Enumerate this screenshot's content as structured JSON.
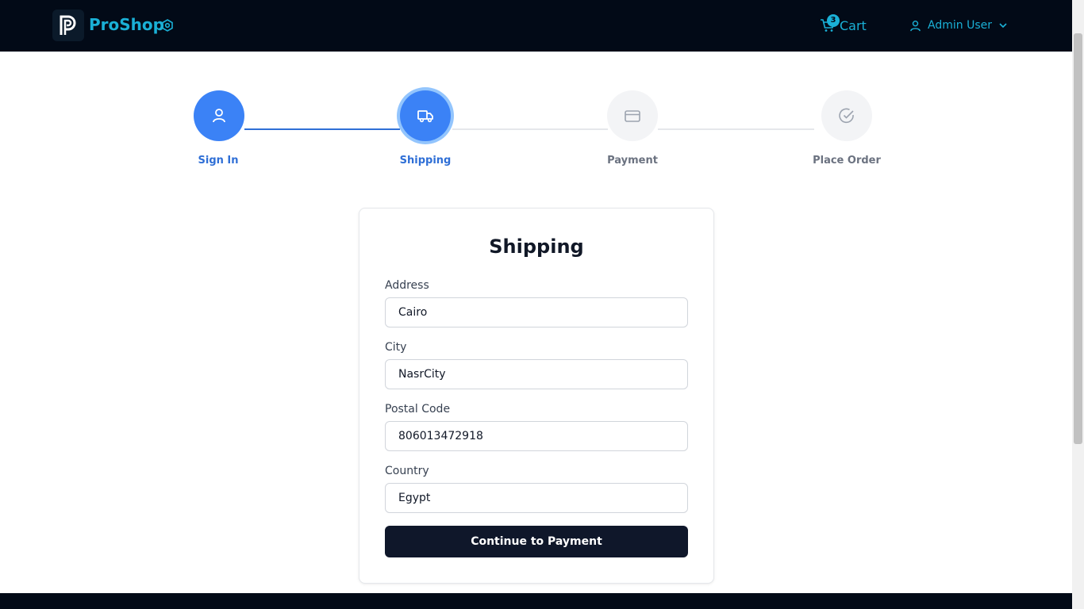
{
  "header": {
    "brand": "ProShop",
    "brand_icon": "settings-icon",
    "cart_label": "Cart",
    "cart_count": "3",
    "user_name": "Admin User",
    "accent_color": "#1ab0d6",
    "background_color": "#020a17"
  },
  "steps": [
    {
      "label": "Sign In",
      "icon": "user-icon",
      "state": "done"
    },
    {
      "label": "Shipping",
      "icon": "truck-icon",
      "state": "current"
    },
    {
      "label": "Payment",
      "icon": "credit-card-icon",
      "state": "todo"
    },
    {
      "label": "Place Order",
      "icon": "check-circle-icon",
      "state": "todo"
    }
  ],
  "form": {
    "title": "Shipping",
    "fields": [
      {
        "label": "Address",
        "value": "Cairo"
      },
      {
        "label": "City",
        "value": "NasrCity"
      },
      {
        "label": "Postal Code",
        "value": "806013472918"
      },
      {
        "label": "Country",
        "value": "Egypt"
      }
    ],
    "submit_label": "Continue to Payment"
  }
}
